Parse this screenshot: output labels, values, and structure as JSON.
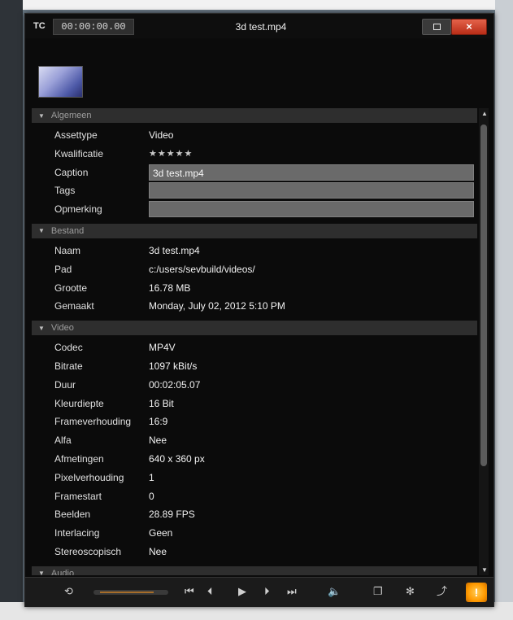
{
  "titlebar": {
    "tc_label": "TC",
    "timecode": "00:00:00.00",
    "title": "3d test.mp4",
    "close_glyph": "×"
  },
  "sections": {
    "algemeen": {
      "header": "Algemeen",
      "rows": [
        {
          "label": "Assettype",
          "value": "Video"
        },
        {
          "label": "Kwalificatie",
          "value": "★★★★★"
        },
        {
          "label": "Caption",
          "value": "3d test.mp4"
        },
        {
          "label": "Tags",
          "value": ""
        },
        {
          "label": "Opmerking",
          "value": ""
        }
      ]
    },
    "bestand": {
      "header": "Bestand",
      "rows": [
        {
          "label": "Naam",
          "value": "3d test.mp4"
        },
        {
          "label": "Pad",
          "value": "c:/users/sevbuild/videos/"
        },
        {
          "label": "Grootte",
          "value": "16.78 MB"
        },
        {
          "label": "Gemaakt",
          "value": "Monday, July 02, 2012 5:10 PM"
        }
      ]
    },
    "video": {
      "header": "Video",
      "rows": [
        {
          "label": "Codec",
          "value": "MP4V"
        },
        {
          "label": "Bitrate",
          "value": "1097 kBit/s"
        },
        {
          "label": "Duur",
          "value": "00:02:05.07"
        },
        {
          "label": "Kleurdiepte",
          "value": "16 Bit"
        },
        {
          "label": "Frameverhouding",
          "value": "16:9"
        },
        {
          "label": "Alfa",
          "value": "Nee"
        },
        {
          "label": "Afmetingen",
          "value": "640 x 360 px"
        },
        {
          "label": "Pixelverhouding",
          "value": "1"
        },
        {
          "label": "Framestart",
          "value": "0"
        },
        {
          "label": "Beelden",
          "value": "28.89 FPS"
        },
        {
          "label": "Interlacing",
          "value": "Geen"
        },
        {
          "label": "Stereoscopisch",
          "value": "Nee"
        }
      ]
    },
    "audio": {
      "header": "Audio"
    }
  },
  "colors": {
    "window_bg": "#0b0b0b",
    "section_header_bg": "#2e2e2e",
    "close_red": "#d14a32",
    "accent_orange": "#ff9a00"
  },
  "icons": {
    "loop": "⟲",
    "to_start": "⏮",
    "prev_frame": "⏴",
    "play": "▶",
    "next_frame": "⏵",
    "to_end": "⏭",
    "volume": "🔈",
    "pages": "❐",
    "gear": "✻",
    "export": "⤴",
    "info": "!"
  }
}
